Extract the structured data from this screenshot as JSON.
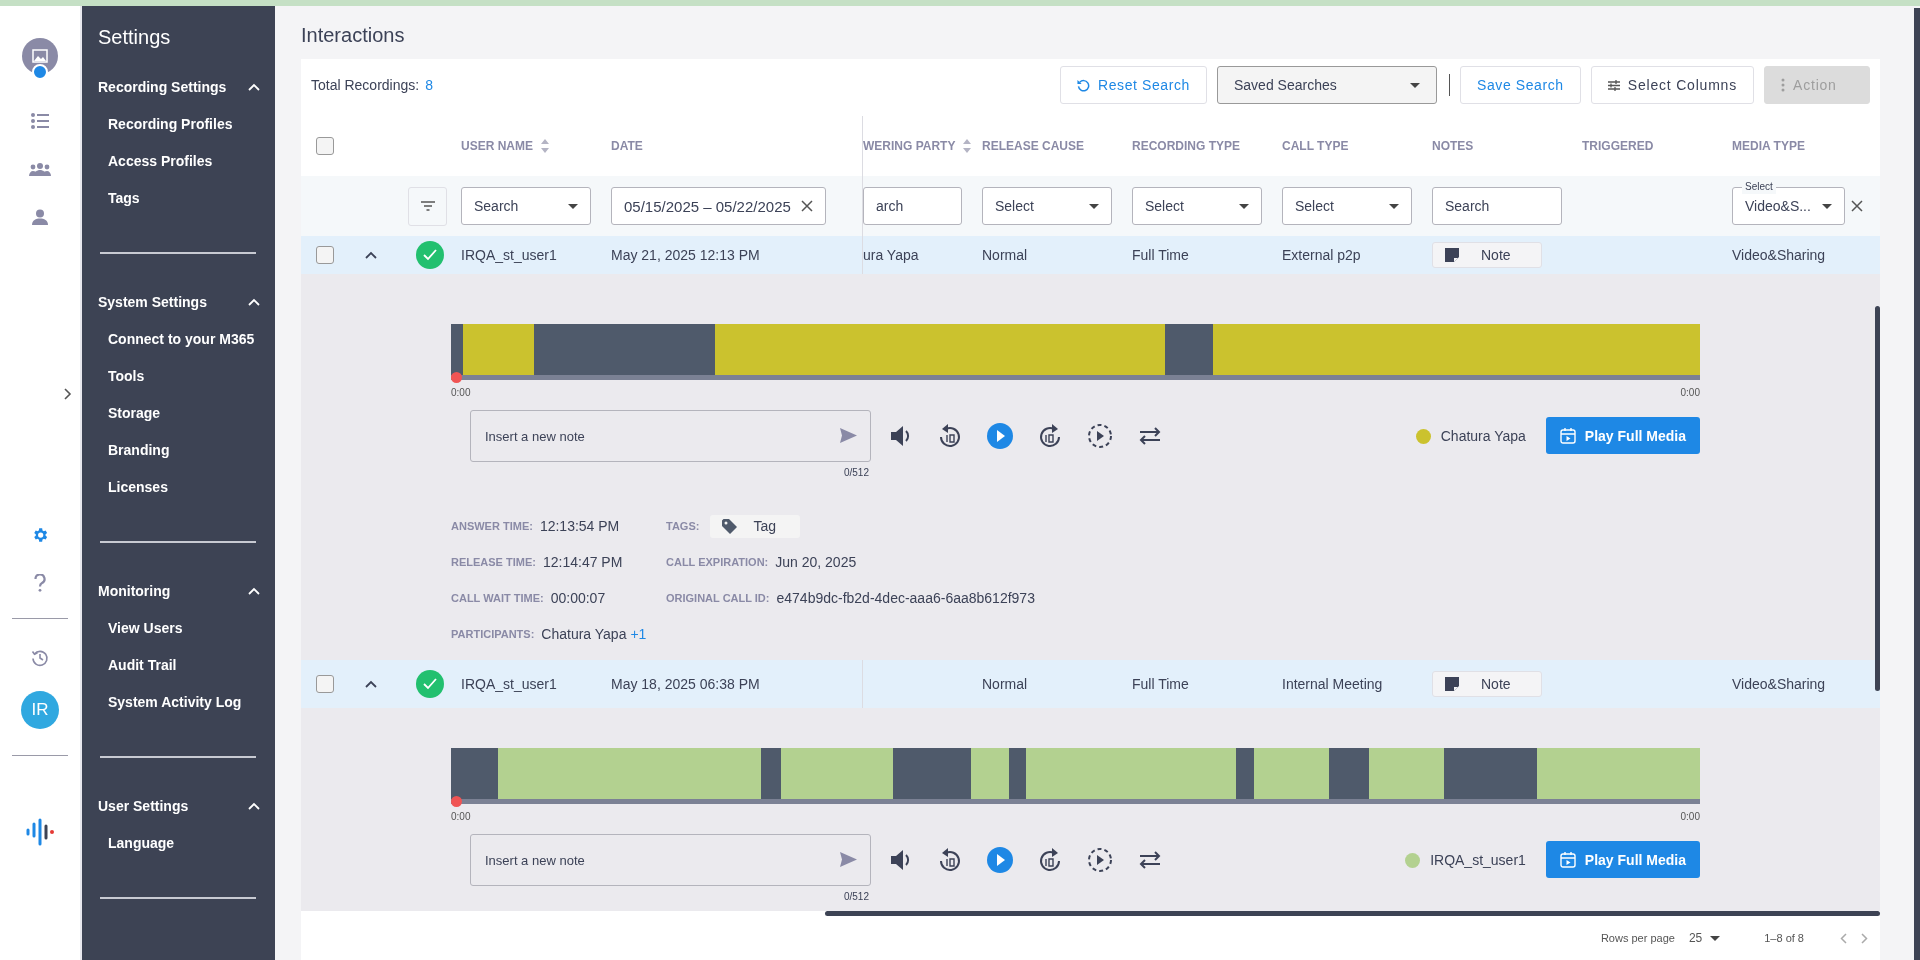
{
  "rail": {
    "items": [
      {
        "kind": "list",
        "selected": false
      },
      {
        "kind": "group",
        "selected": false
      },
      {
        "kind": "person",
        "selected": false
      },
      {
        "kind": "settings",
        "selected": true
      },
      {
        "kind": "help",
        "selected": false
      },
      {
        "kind": "history",
        "selected": false
      }
    ],
    "user_initials": "IR"
  },
  "sidebar": {
    "title": "Settings",
    "sections": [
      {
        "title": "Recording Settings",
        "expanded": true,
        "items": [
          "Recording Profiles",
          "Access Profiles",
          "Tags"
        ]
      },
      {
        "title": "System Settings",
        "expanded": true,
        "items": [
          "Connect to your M365",
          "Tools",
          "Storage",
          "Branding",
          "Licenses"
        ]
      },
      {
        "title": "Monitoring",
        "expanded": true,
        "items": [
          "View Users",
          "Audit Trail",
          "System Activity Log"
        ]
      },
      {
        "title": "User Settings",
        "expanded": true,
        "items": [
          "Language"
        ]
      }
    ]
  },
  "page": {
    "title": "Interactions",
    "total_label": "Total Recordings:",
    "total": "8"
  },
  "toolbar": [
    {
      "kind": "reset",
      "label": "Reset Search",
      "disabled": false
    },
    {
      "kind": "dropdown",
      "label": "Saved Searches",
      "disabled": false
    },
    {
      "kind": "link",
      "label": "Save Search",
      "disabled": false
    },
    {
      "kind": "columns",
      "label": "Select Columns",
      "disabled": false
    },
    {
      "kind": "action",
      "label": "Action",
      "disabled": true
    }
  ],
  "table": {
    "select_all": {
      "checked": false
    },
    "columns": [
      {
        "label": "USER NAME",
        "sortable": true
      },
      {
        "label": "DATE",
        "sortable": false
      },
      {
        "label": "WERING PARTY",
        "sortable": true
      },
      {
        "label": "RELEASE CAUSE",
        "sortable": false
      },
      {
        "label": "RECORDING TYPE",
        "sortable": false
      },
      {
        "label": "CALL TYPE",
        "sortable": false
      },
      {
        "label": "NOTES",
        "sortable": false
      },
      {
        "label": "TRIGGERED",
        "sortable": false
      },
      {
        "label": "MEDIA TYPE",
        "sortable": false
      }
    ],
    "filters": [
      {
        "kind": "select",
        "placeholder": "Search"
      },
      {
        "kind": "daterange",
        "value": "05/15/2025 – 05/22/2025"
      },
      {
        "kind": "text",
        "placeholder": "arch"
      },
      {
        "kind": "select",
        "placeholder": "Select"
      },
      {
        "kind": "select",
        "placeholder": "Select"
      },
      {
        "kind": "select",
        "placeholder": "Select"
      },
      {
        "kind": "text",
        "placeholder": "Search"
      },
      {
        "kind": "empty"
      },
      {
        "kind": "labeled-select",
        "label": "Select",
        "value": "Video&S..."
      }
    ],
    "rows": [
      {
        "selected": false,
        "expanded": true,
        "kind": "success",
        "cells": [
          "IRQA_st_user1",
          "May 21, 2025 12:13 PM",
          "ura Yapa",
          "Normal",
          "Full Time",
          "External p2p",
          "",
          "",
          "Video&Sharing"
        ],
        "note": "Note",
        "player": {
          "level": 0,
          "start": "0:00",
          "end": "0:00",
          "note_placeholder": "Insert a new note",
          "note_count": "0/512",
          "speaker": "Chatura Yapa",
          "color": "#cbc22e",
          "play_label": "Play Full Media"
        },
        "details": {
          "left": [
            {
              "label": "ANSWER TIME:",
              "value": "12:13:54 PM"
            },
            {
              "label": "RELEASE TIME:",
              "value": "12:14:47 PM"
            },
            {
              "label": "CALL WAIT TIME:",
              "value": "00:00:07"
            },
            {
              "label": "PARTICIPANTS:",
              "value": "Chatura Yapa",
              "more": "+1"
            }
          ],
          "right": [
            {
              "label": "TAGS:",
              "tags": [
                "Tag"
              ]
            },
            {
              "label": "CALL EXPIRATION:",
              "value": "Jun 20, 2025"
            },
            {
              "label": "ORIGINAL CALL ID:",
              "value": "e474b9dc-fb2d-4dec-aaa6-6aa8b612f973"
            }
          ]
        }
      },
      {
        "selected": false,
        "expanded": true,
        "kind": "success",
        "cells": [
          "IRQA_st_user1",
          "May 18, 2025 06:38 PM",
          "",
          "Normal",
          "Full Time",
          "Internal Meeting",
          "",
          "",
          "Video&Sharing"
        ],
        "note": "Note",
        "player": {
          "level": 0,
          "start": "0:00",
          "end": "0:00",
          "note_placeholder": "Insert a new note",
          "note_count": "0/512",
          "speaker": "IRQA_st_user1",
          "color": "#b3d190",
          "play_label": "Play Full Media"
        }
      }
    ]
  },
  "footer": {
    "rows_label": "Rows per page",
    "rows_value": "25",
    "range": "1–8 of 8"
  }
}
